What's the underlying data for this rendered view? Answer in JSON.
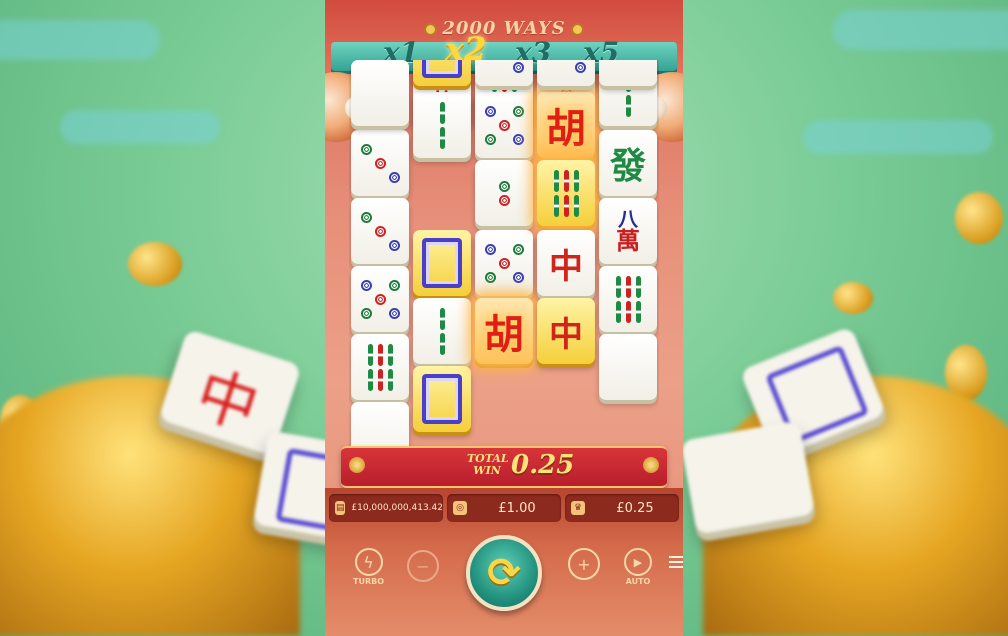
{
  "ways_label": "2000 WAYS",
  "multipliers": [
    {
      "label": "x1",
      "active": false
    },
    {
      "label": "x2",
      "active": true
    },
    {
      "label": "x3",
      "active": false
    },
    {
      "label": "x5",
      "active": false
    }
  ],
  "reels": [
    [
      "dots-3",
      "dots-3",
      "dots-5",
      "bamboo-6",
      "partial"
    ],
    [
      "wan-8",
      "bamboo-2",
      "frame-gold",
      "bamboo-2",
      "frame-gold"
    ],
    [
      "bamboo-6",
      "dots-5",
      "dots-2",
      "dots-5",
      "hu"
    ],
    [
      "dots-3",
      "hu",
      "bamboo-6-gold",
      "zhong",
      "zhong-gold"
    ],
    [
      "bamboo-2",
      "fa",
      "wan-8",
      "bamboo-6",
      "partial"
    ]
  ],
  "total_win": {
    "label": "TOTAL WIN",
    "value": "0.25"
  },
  "balance": "£10,000,000,413.42",
  "bet": "£1.00",
  "win": "£0.25",
  "controls": {
    "turbo_label": "TURBO",
    "auto_label": "AUTO"
  },
  "symbols": {
    "hu": "胡",
    "zhong": "中",
    "fa": "發",
    "wan_num": "八",
    "wan": "萬"
  },
  "colors": {
    "accent": "#ffe27a",
    "spin": "#23927f",
    "panel": "#b8452f"
  }
}
